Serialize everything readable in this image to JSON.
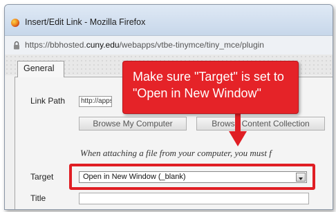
{
  "window": {
    "title": "Insert/Edit Link - Mozilla Firefox",
    "url_prefix": "https://bbhosted.",
    "url_domain": "cuny.edu",
    "url_suffix": "/webapps/vtbe-tinymce/tiny_mce/plugin"
  },
  "tabs": {
    "general": "General"
  },
  "form": {
    "link_path_label": "Link Path",
    "link_path_value": "http://apps.a",
    "browse_computer": "Browse My Computer",
    "browse_content": "Browse Content Collection",
    "hint": "When attaching a file from your computer, you must f",
    "target_label": "Target",
    "target_value": "Open in New Window (_blank)",
    "title_label": "Title"
  },
  "callout": {
    "line1": "Make sure \"Target\" is set to",
    "line2": "\"Open in New Window\""
  },
  "colors": {
    "annotation_red": "#e52328",
    "titlebar": "#c7d7ea"
  },
  "icons": [
    "firefox-icon",
    "lock-icon",
    "dropdown-arrow-icon",
    "arrow-down-icon"
  ]
}
